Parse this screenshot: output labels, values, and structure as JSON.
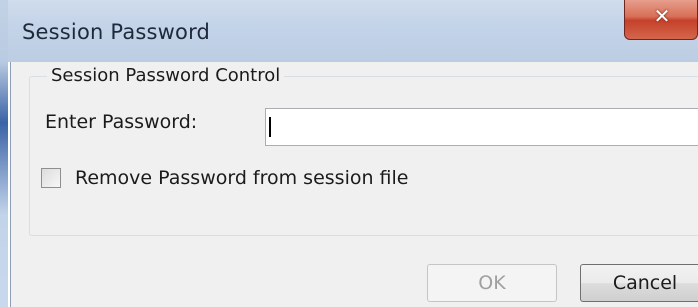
{
  "window": {
    "title": "Session Password",
    "close_glyph": "✕",
    "close_icon": "close-icon"
  },
  "group": {
    "label": "Session Password Control"
  },
  "password": {
    "label": "Enter Password:",
    "value": "",
    "placeholder": ""
  },
  "remove_option": {
    "label": "Remove Password from session file",
    "checked": false
  },
  "buttons": {
    "ok_label": "OK",
    "ok_enabled": false,
    "cancel_label": "Cancel"
  },
  "colors": {
    "titlebar": "#c3d3e8",
    "client_bg": "#f0f0f0",
    "close_button": "#c4412a",
    "disabled_text": "#a0a0a0"
  }
}
